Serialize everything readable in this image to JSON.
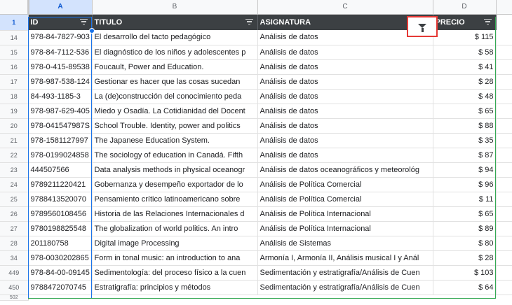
{
  "columns": [
    "A",
    "B",
    "C",
    "D"
  ],
  "header_row_number": "1",
  "headers": [
    "ID",
    "TITULO",
    "ASIGNATURA",
    "PRECIO"
  ],
  "rows": [
    {
      "n": "14",
      "id": "978-84-7827-903",
      "titulo": "El desarrollo del tacto pedagógico",
      "asignatura": "Análisis de datos",
      "precio": "$ 115"
    },
    {
      "n": "15",
      "id": "978-84-7112-536",
      "titulo": "El diagnóstico de los niños y adolescentes p",
      "asignatura": "Análisis de datos",
      "precio": "$ 58"
    },
    {
      "n": "16",
      "id": "978-0-415-89538",
      "titulo": "Foucault, Power and Education.",
      "asignatura": "Análisis de datos",
      "precio": "$ 41"
    },
    {
      "n": "17",
      "id": "978-987-538-124",
      "titulo": "Gestionar es hacer que las cosas sucedan",
      "asignatura": "Análisis de datos",
      "precio": "$ 28"
    },
    {
      "n": "18",
      "id": "84-493-1185-3",
      "titulo": "La (de)construcción del conocimiento peda",
      "asignatura": "Análisis de datos",
      "precio": "$ 48"
    },
    {
      "n": "19",
      "id": "978-987-629-405",
      "titulo": "Miedo y Osadía. La Cotidianidad del Docent",
      "asignatura": "Análisis de datos",
      "precio": "$ 65"
    },
    {
      "n": "20",
      "id": "978-041547987S",
      "titulo": "School Trouble. Identity, power and politics",
      "asignatura": "Análisis de datos",
      "precio": "$ 88"
    },
    {
      "n": "21",
      "id": "978-1581127997",
      "titulo": "The Japanese Education System.",
      "asignatura": "Análisis de datos",
      "precio": "$ 35"
    },
    {
      "n": "22",
      "id": "978-0199024858",
      "titulo": "The sociology of education in Canadá. Fifth",
      "asignatura": "Análisis de datos",
      "precio": "$ 87"
    },
    {
      "n": "23",
      "id": "444507566",
      "titulo": "Data analysis methods in physical oceanogr",
      "asignatura": "Análisis de datos oceanográficos y meteorológ",
      "precio": "$ 94"
    },
    {
      "n": "24",
      "id": "9789211220421",
      "titulo": "Gobernanza y desempeño exportador de lo",
      "asignatura": "Análisis de Política Comercial",
      "precio": "$ 96"
    },
    {
      "n": "25",
      "id": "9788413520070",
      "titulo": "Pensamiento crítico latinoamericano sobre",
      "asignatura": "Análisis de Política Comercial",
      "precio": "$ 11"
    },
    {
      "n": "26",
      "id": "9789560108456",
      "titulo": "Historia de las Relaciones Internacionales d",
      "asignatura": "Análisis de Política Internacional",
      "precio": "$ 65"
    },
    {
      "n": "27",
      "id": "9780198825548",
      "titulo": "The globalization of world politics. An intro",
      "asignatura": "Análisis de Política Internacional",
      "precio": "$ 89"
    },
    {
      "n": "28",
      "id": "201180758",
      "titulo": "Digital image Processing",
      "asignatura": "Análisis de Sistemas",
      "precio": "$ 80"
    },
    {
      "n": "34",
      "id": "978-0030202865",
      "titulo": "Form in tonal music: an introduction to ana",
      "asignatura": "Armonía I, Armonía II, Análisis musical I y Anál",
      "precio": "$ 28"
    },
    {
      "n": "449",
      "id": "978-84-00-09145",
      "titulo": "Sedimentología: del proceso físico a la cuen",
      "asignatura": "Sedimentación y estratigrafía/Análisis de Cuen",
      "precio": "$ 103"
    },
    {
      "n": "450",
      "id": "9788472070745",
      "titulo": "Estratigrafía: principios y métodos",
      "asignatura": "Sedimentación y estratigrafía/Análisis de Cuen",
      "precio": "$ 64"
    }
  ],
  "next_row_number": "502",
  "colors": {
    "header_bg": "#3c4043",
    "selection": "#1a73e8",
    "filter_highlight": "#e53935",
    "table_border": "#34a853"
  }
}
